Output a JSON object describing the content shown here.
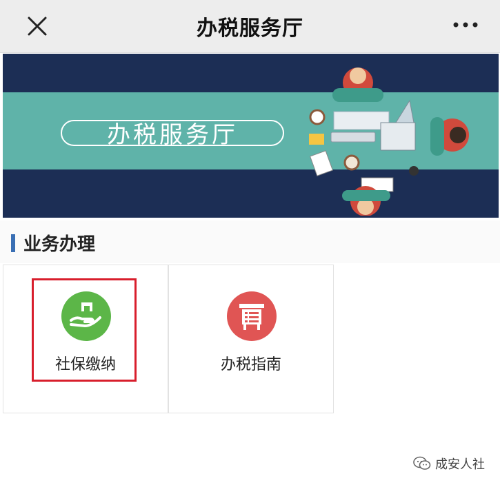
{
  "header": {
    "title": "办税服务厅",
    "close_icon": "close-icon",
    "more_icon": "more-dots-icon"
  },
  "banner": {
    "title": "办税服务厅",
    "colors": {
      "navy": "#1c2e55",
      "teal": "#5fb3a9"
    }
  },
  "section": {
    "title": "业务办理",
    "accent": "#3a6fb4"
  },
  "tiles": [
    {
      "label": "社保缴纳",
      "icon": "hand-house-icon",
      "color": "#5cb648",
      "highlighted": true
    },
    {
      "label": "办税指南",
      "icon": "guide-board-icon",
      "color": "#e05554",
      "highlighted": false
    }
  ],
  "highlight_color": "#d81e2c",
  "watermark": {
    "text": "成安人社",
    "icon": "wechat-icon"
  }
}
